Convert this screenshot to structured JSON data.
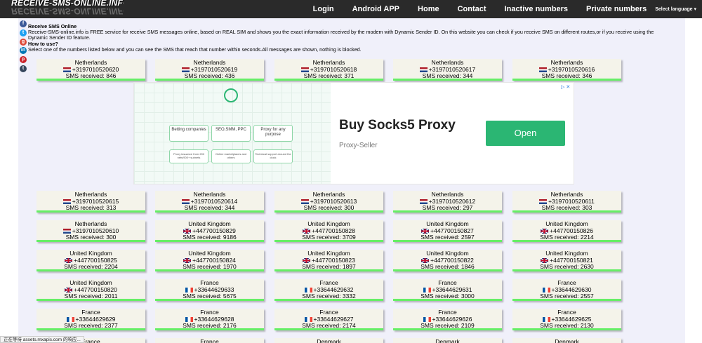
{
  "header": {
    "logo_text": "RECEIVE-SMS-ONLINE.INFO",
    "nav": [
      "Login",
      "Android APP",
      "Home",
      "Contact",
      "Inactive numbers",
      "Private numbers"
    ],
    "language_label": "Select language ▾"
  },
  "social_icons": [
    "facebook-icon",
    "twitter-icon",
    "google-plus-icon",
    "linkedin-icon",
    "pinterest-icon",
    "tumblr-icon"
  ],
  "intro": {
    "title": "Receive SMS Online",
    "text": "Receive-SMS-online.info is FREE service for receive SMS messages online, based on REAL SIM and shows you the exact information received by the modem with Dynamic Sender ID. On this website you can check if you receive SMS on different routes,or if you receive using the Dynamic Sender ID feature.",
    "howto_title": "How to use?",
    "howto_text": "Select one of the numbers listed below and you can see the SMS that reach that number within seconds.All messages are shown, nothing is blocked."
  },
  "ad": {
    "title": "Buy Socks5 Proxy",
    "subtitle": "Proxy-Seller",
    "button": "Open",
    "close": "▷ ✕",
    "boxes": [
      "Betting companies",
      "SEO,SMM, PPC",
      "Proxy for any purpose",
      "Proxy issuance from 200 nets/900+ subnets",
      "Online marketplaces and others",
      "Technical support around the clock"
    ]
  },
  "cards_rows": [
    [
      {
        "country": "Netherlands",
        "flag": "nl",
        "number": "+3197010520620",
        "sms": "SMS received: 846"
      },
      {
        "country": "Netherlands",
        "flag": "nl",
        "number": "+3197010520619",
        "sms": "SMS received: 436"
      },
      {
        "country": "Netherlands",
        "flag": "nl",
        "number": "+3197010520618",
        "sms": "SMS received: 371"
      },
      {
        "country": "Netherlands",
        "flag": "nl",
        "number": "+3197010520617",
        "sms": "SMS received: 344"
      },
      {
        "country": "Netherlands",
        "flag": "nl",
        "number": "+3197010520616",
        "sms": "SMS received: 346"
      }
    ],
    [
      {
        "country": "Netherlands",
        "flag": "nl",
        "number": "+3197010520615",
        "sms": "SMS received: 313"
      },
      {
        "country": "Netherlands",
        "flag": "nl",
        "number": "+3197010520614",
        "sms": "SMS received: 344"
      },
      {
        "country": "Netherlands",
        "flag": "nl",
        "number": "+3197010520613",
        "sms": "SMS received: 300"
      },
      {
        "country": "Netherlands",
        "flag": "nl",
        "number": "+3197010520612",
        "sms": "SMS received: 297"
      },
      {
        "country": "Netherlands",
        "flag": "nl",
        "number": "+3197010520611",
        "sms": "SMS received: 303"
      }
    ],
    [
      {
        "country": "Netherlands",
        "flag": "nl",
        "number": "+3197010520610",
        "sms": "SMS received: 300"
      },
      {
        "country": "United Kingdom",
        "flag": "uk",
        "number": "+447700150829",
        "sms": "SMS received: 9186"
      },
      {
        "country": "United Kingdom",
        "flag": "uk",
        "number": "+447700150828",
        "sms": "SMS received: 3709"
      },
      {
        "country": "United Kingdom",
        "flag": "uk",
        "number": "+447700150827",
        "sms": "SMS received: 2597"
      },
      {
        "country": "United Kingdom",
        "flag": "uk",
        "number": "+447700150826",
        "sms": "SMS received: 2214"
      }
    ],
    [
      {
        "country": "United Kingdom",
        "flag": "uk",
        "number": "+447700150825",
        "sms": "SMS received: 2204"
      },
      {
        "country": "United Kingdom",
        "flag": "uk",
        "number": "+447700150824",
        "sms": "SMS received: 1970"
      },
      {
        "country": "United Kingdom",
        "flag": "uk",
        "number": "+447700150823",
        "sms": "SMS received: 1897"
      },
      {
        "country": "United Kingdom",
        "flag": "uk",
        "number": "+447700150822",
        "sms": "SMS received: 1846"
      },
      {
        "country": "United Kingdom",
        "flag": "uk",
        "number": "+447700150821",
        "sms": "SMS received: 2630"
      }
    ],
    [
      {
        "country": "United Kingdom",
        "flag": "uk",
        "number": "+447700150820",
        "sms": "SMS received: 2011"
      },
      {
        "country": "France",
        "flag": "fr",
        "number": "+33644629633",
        "sms": "SMS received: 5675"
      },
      {
        "country": "France",
        "flag": "fr",
        "number": "+33644629632",
        "sms": "SMS received: 3332"
      },
      {
        "country": "France",
        "flag": "fr",
        "number": "+33644629631",
        "sms": "SMS received: 3000"
      },
      {
        "country": "France",
        "flag": "fr",
        "number": "+33644629630",
        "sms": "SMS received: 2557"
      }
    ],
    [
      {
        "country": "France",
        "flag": "fr",
        "number": "+33644629629",
        "sms": "SMS received: 2377"
      },
      {
        "country": "France",
        "flag": "fr",
        "number": "+33644629628",
        "sms": "SMS received: 2176"
      },
      {
        "country": "France",
        "flag": "fr",
        "number": "+33644629627",
        "sms": "SMS received: 2174"
      },
      {
        "country": "France",
        "flag": "fr",
        "number": "+33644629626",
        "sms": "SMS received: 2109"
      },
      {
        "country": "France",
        "flag": "fr",
        "number": "+33644629625",
        "sms": "SMS received: 2130"
      }
    ],
    [
      {
        "country": "France",
        "flag": "fr",
        "number": "",
        "sms": ""
      },
      {
        "country": "France",
        "flag": "fr",
        "number": "",
        "sms": ""
      },
      {
        "country": "Denmark",
        "flag": "dk",
        "number": "",
        "sms": ""
      },
      {
        "country": "Denmark",
        "flag": "dk",
        "number": "",
        "sms": ""
      },
      {
        "country": "Denmark",
        "flag": "dk",
        "number": "",
        "sms": ""
      }
    ]
  ],
  "statusbar": "正在等待 assets.mxapis.com 的响应...",
  "colors": {
    "topbar": "#2a2a2a",
    "card_bg": "#f4f3ea",
    "card_accent": "#66ee66",
    "page_bg": "#f0f0fa",
    "ad_button": "#2bb673"
  }
}
